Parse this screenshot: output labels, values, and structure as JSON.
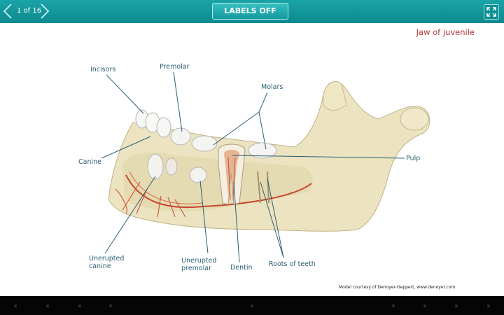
{
  "header": {
    "page_count": "1 of 16",
    "labels_button": "LABELS OFF"
  },
  "title": "Jaw of juvenile",
  "labels": {
    "incisors": "Incisors",
    "premolar": "Premolar",
    "molars": "Molars",
    "canine": "Canine",
    "pulp": "Pulp",
    "unerupted_canine_1": "Unerupted",
    "unerupted_canine_2": "canine",
    "unerupted_premolar_1": "Unerupted",
    "unerupted_premolar_2": "premolar",
    "dentin": "Dentin",
    "roots": "Roots of teeth"
  },
  "credit": "Model courtesy of Denoyer-Geppert, www.denoyer.com",
  "icons": [
    "chevron-left-icon",
    "chevron-right-icon",
    "fullscreen-icon"
  ],
  "colors": {
    "accent": "#0d8a8f",
    "title": "#b0383a",
    "label": "#2c5f73"
  }
}
